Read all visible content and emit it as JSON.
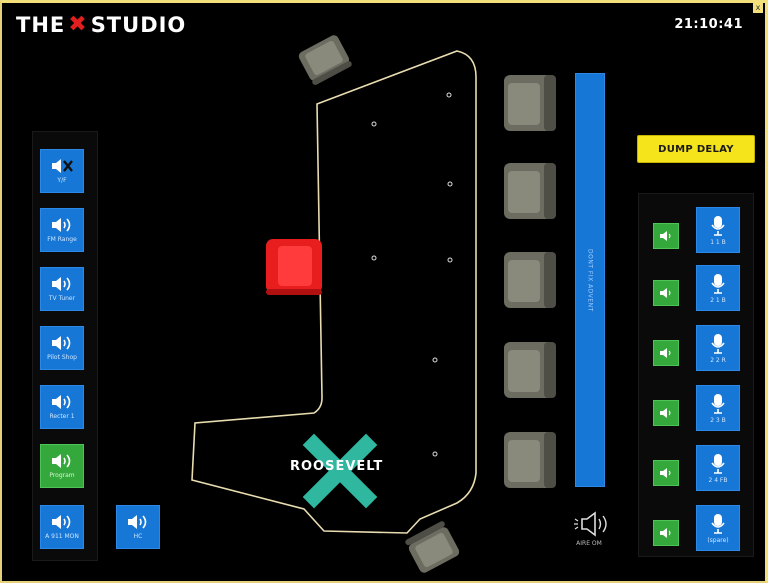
{
  "header": {
    "brand_left": "THE",
    "brand_right": "STUDIO",
    "clock": "21:10:41"
  },
  "left_panel": {
    "buttons": [
      {
        "label": "Y/F",
        "icon": "speaker-muted-icon"
      },
      {
        "label": "FM Range",
        "icon": "speaker-icon"
      },
      {
        "label": "TV Tuner",
        "icon": "speaker-icon"
      },
      {
        "label": "Pilot Shop",
        "icon": "speaker-icon"
      },
      {
        "label": "Recter 1",
        "icon": "speaker-icon"
      },
      {
        "label": "Program",
        "icon": "speaker-icon",
        "active": true
      },
      {
        "label": "A 911 MON",
        "icon": "speaker-icon"
      }
    ],
    "extra_button": {
      "label": "HC",
      "icon": "speaker-icon"
    }
  },
  "stage": {
    "room_label": "ROOSEVELT"
  },
  "blue_bar": {
    "label": "DONT FIX ADVENT"
  },
  "air_label": "AIRE OM",
  "right_panel": {
    "dump_delay": "DUMP DELAY",
    "rows": [
      {
        "mic_label": "1 1 B"
      },
      {
        "mic_label": "2 1 B"
      },
      {
        "mic_label": "2 2 R"
      },
      {
        "mic_label": "2 3 B"
      },
      {
        "mic_label": "2 4 FB"
      },
      {
        "mic_label": "(spare)"
      }
    ]
  },
  "colors": {
    "accent_blue": "#1677d6",
    "active_green": "#34a83a",
    "alert_red": "#e01f1f",
    "dump_yellow": "#f5e31b",
    "frame_gold": "#f3e07a"
  }
}
